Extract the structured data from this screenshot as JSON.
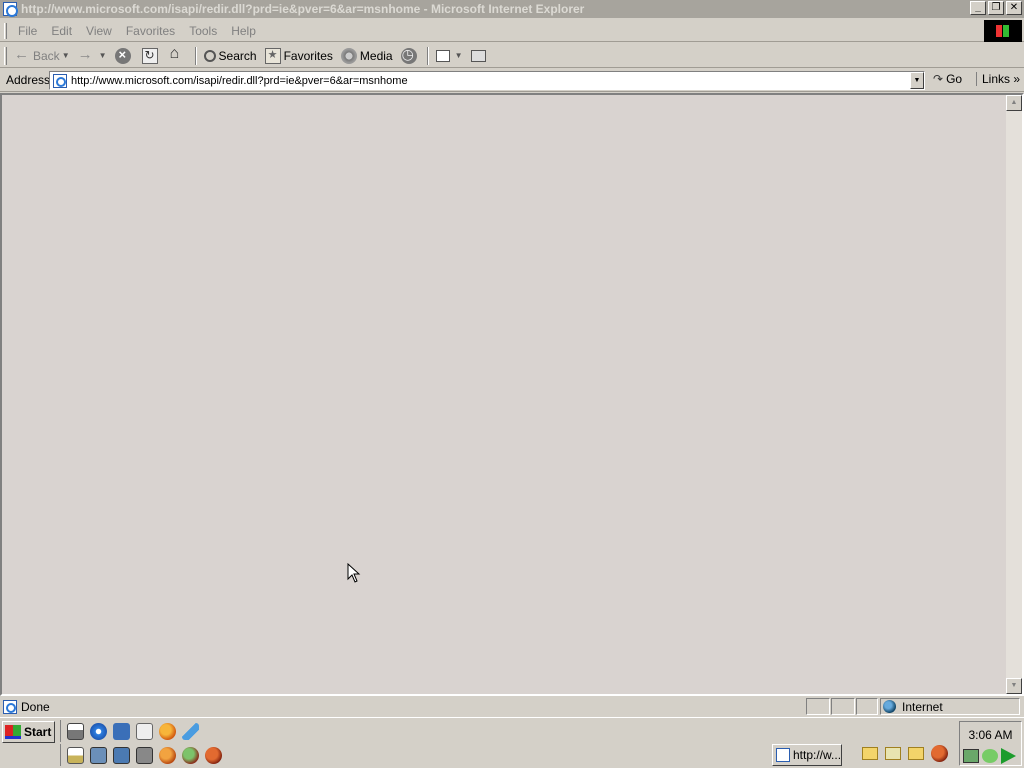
{
  "window": {
    "title": "http://www.microsoft.com/isapi/redir.dll?prd=ie&pver=6&ar=msnhome - Microsoft Internet Explorer",
    "controls": {
      "minimize": "_",
      "restore": "❐",
      "close": "✕"
    }
  },
  "menu": [
    "File",
    "Edit",
    "View",
    "Favorites",
    "Tools",
    "Help"
  ],
  "toolbar": {
    "back": "Back",
    "search": "Search",
    "favorites": "Favorites",
    "media": "Media"
  },
  "address": {
    "label": "Address",
    "url": "http://www.microsoft.com/isapi/redir.dll?prd=ie&pver=6&ar=msnhome",
    "go": "Go",
    "links": "Links",
    "links_more": "»"
  },
  "status": {
    "text": "Done",
    "zone": "Internet"
  },
  "taskbar": {
    "start": "Start",
    "task_label": "http://w...",
    "clock": "3:06 AM"
  },
  "icons": {
    "app": "ie-icon",
    "back": "back-arrow-icon",
    "forward": "forward-arrow-icon",
    "stop": "stop-icon",
    "refresh": "refresh-icon",
    "home": "home-icon",
    "search": "search-icon",
    "favorites": "favorites-icon",
    "media": "media-icon",
    "history": "history-icon",
    "mail": "mail-icon",
    "print": "print-icon"
  }
}
